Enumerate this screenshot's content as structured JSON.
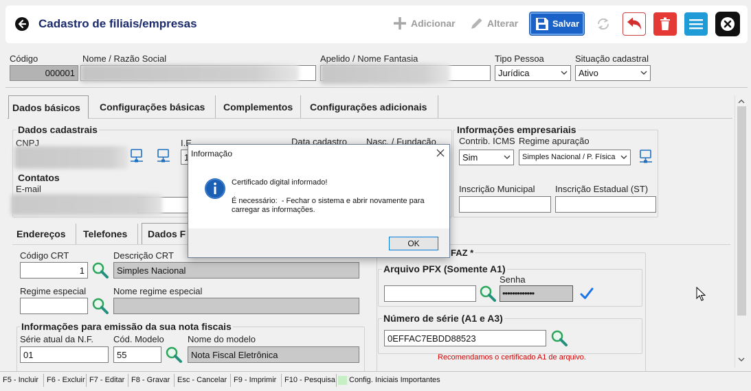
{
  "header": {
    "title": "Cadastro de filiais/empresas",
    "add_label": "Adicionar",
    "edit_label": "Alterar",
    "save_label": "Salvar"
  },
  "top_fields": {
    "codigo_label": "Código",
    "codigo_value": "000001",
    "nome_label": "Nome / Razão Social",
    "apelido_label": "Apelido / Nome Fantasia",
    "tipo_pessoa_label": "Tipo Pessoa",
    "tipo_pessoa_value": "Jurídica",
    "situacao_label": "Situação cadastral",
    "situacao_value": "Ativo"
  },
  "tabs": [
    "Dados básicos",
    "Configurações básicas",
    "Complementos",
    "Configurações adicionais"
  ],
  "dados_cadastrais": {
    "title": "Dados cadastrais",
    "cnpj_label": "CNPJ",
    "ie_label": "I.E.",
    "ie_value": "1",
    "data_cadastro_label": "Data cadastro",
    "nasc_fundacao_label": "Nasc. / Fundação"
  },
  "contatos": {
    "title": "Contatos",
    "email_label": "E-mail"
  },
  "informacoes_empresariais": {
    "title": "Informações empresariais",
    "contrib_icms_label": "Contrib. ICMS",
    "contrib_icms_value": "Sim",
    "regime_apuracao_label": "Regime apuração",
    "regime_apuracao_value": "Simples Nacional / P. Física",
    "inscricao_municipal_label": "Inscrição Municipal",
    "inscricao_estadual_st_label": "Inscrição Estadual (ST)"
  },
  "subtabs": [
    "Endereços",
    "Telefones",
    "Dados F"
  ],
  "fiscal": {
    "crt_label": "Código CRT",
    "crt_value": "1",
    "descricao_crt_label": "Descrição CRT",
    "descricao_crt_value": "Simples Nacional",
    "regime_especial_label": "Regime especial",
    "nome_regime_label": "Nome regime especial",
    "emissao_title": "Informações para emissão da sua nota fiscais",
    "serie_label": "Série atual da N.F.",
    "serie_value": "01",
    "modelo_label": "Cód. Modelo",
    "modelo_value": "55",
    "nome_modelo_label": "Nome do modelo",
    "nome_modelo_value": "Nota Fiscal Eletrônica"
  },
  "certificado": {
    "title": "FAZ *",
    "pfx_title": "Arquivo PFX (Somente A1)",
    "senha_label": "Senha",
    "senha_value": "•••••••••••••",
    "serie_title": "Número de série (A1 e A3)",
    "serie_value": "0EFFAC7EBDD88523",
    "note": "Recomendamos o certificado A1 de arquivo."
  },
  "dialog": {
    "title": "Informação",
    "message": "Certificado digital informado!",
    "detail_line1": "É necessário:  - Fechar o sistema e abrir novamente para",
    "detail_line2": "carregar as informações.",
    "ok_label": "OK"
  },
  "statusbar": {
    "shortcuts": [
      "F5 - Incluir",
      "F6 - Excluir",
      "F7 - Editar",
      "F8 - Gravar",
      "Esc - Cancelar",
      "F9 - Imprimir",
      "F10 - Pesquisa"
    ],
    "config_label": "Config. Iniciais Importantes"
  },
  "colors": {
    "title_text": "#1a2a6c",
    "save_button": "#1a62c8",
    "delete_button": "#e53935",
    "menu_button": "#1f9bd7",
    "close_button": "#111111",
    "note_text": "#d40000",
    "config_indicator": "#c6efc6",
    "search_icon": "#2aa55a",
    "check_icon": "#1a73e8"
  }
}
